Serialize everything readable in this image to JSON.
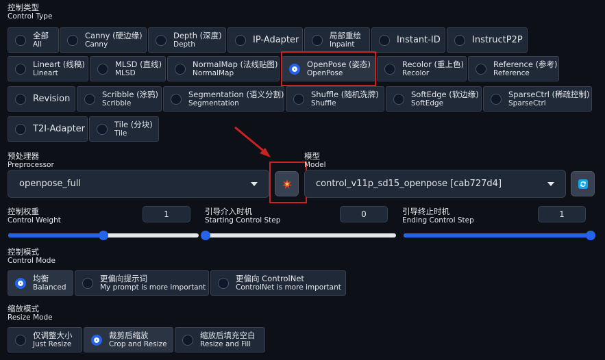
{
  "control_type": {
    "label_cn": "控制类型",
    "label_en": "Control Type",
    "options": [
      {
        "l1": "全部",
        "l2": "All",
        "selected": false
      },
      {
        "l1": "Canny (硬边缘)",
        "l2": "Canny",
        "selected": false
      },
      {
        "l1": "Depth (深度)",
        "l2": "Depth",
        "selected": false
      },
      {
        "l1": "IP-Adapter",
        "l2": "",
        "selected": false
      },
      {
        "l1": "局部重绘",
        "l2": "Inpaint",
        "selected": false
      },
      {
        "l1": "Instant-ID",
        "l2": "",
        "selected": false
      },
      {
        "l1": "InstructP2P",
        "l2": "",
        "selected": false
      },
      {
        "l1": "Lineart (线稿)",
        "l2": "Lineart",
        "selected": false
      },
      {
        "l1": "MLSD (直线)",
        "l2": "MLSD",
        "selected": false
      },
      {
        "l1": "NormalMap (法线贴图)",
        "l2": "NormalMap",
        "selected": false
      },
      {
        "l1": "OpenPose (姿态)",
        "l2": "OpenPose",
        "selected": true
      },
      {
        "l1": "Recolor (重上色)",
        "l2": "Recolor",
        "selected": false
      },
      {
        "l1": "Reference (参考)",
        "l2": "Reference",
        "selected": false
      },
      {
        "l1": "Revision",
        "l2": "",
        "selected": false
      },
      {
        "l1": "Scribble (涂鸦)",
        "l2": "Scribble",
        "selected": false
      },
      {
        "l1": "Segmentation (语义分割)",
        "l2": "Segmentation",
        "selected": false
      },
      {
        "l1": "Shuffle (随机洗牌)",
        "l2": "Shuffle",
        "selected": false
      },
      {
        "l1": "SoftEdge (软边缘)",
        "l2": "SoftEdge",
        "selected": false
      },
      {
        "l1": "SparseCtrl (稀疏控制)",
        "l2": "SparseCtrl",
        "selected": false
      },
      {
        "l1": "T2I-Adapter",
        "l2": "",
        "selected": false
      },
      {
        "l1": "Tile (分块)",
        "l2": "Tile",
        "selected": false
      }
    ]
  },
  "preprocessor": {
    "label_cn": "预处理器",
    "label_en": "Preprocessor",
    "value": "openpose_full"
  },
  "model": {
    "label_cn": "模型",
    "label_en": "Model",
    "value": "control_v11p_sd15_openpose [cab727d4]"
  },
  "run_preprocessor_icon": "explosion-icon",
  "refresh_icon": "refresh-icon",
  "control_weight": {
    "label_cn": "控制权重",
    "label_en": "Control Weight",
    "value": "1",
    "fraction": 0.5
  },
  "starting_step": {
    "label_cn": "引导介入时机",
    "label_en": "Starting Control Step",
    "value": "0",
    "fraction": 0.0
  },
  "ending_step": {
    "label_cn": "引导终止时机",
    "label_en": "Ending Control Step",
    "value": "1",
    "fraction": 1.0
  },
  "control_mode": {
    "label_cn": "控制模式",
    "label_en": "Control Mode",
    "options": [
      {
        "l1": "均衡",
        "l2": "Balanced",
        "selected": true
      },
      {
        "l1": "更偏向提示词",
        "l2": "My prompt is more important",
        "selected": false
      },
      {
        "l1": "更偏向 ControlNet",
        "l2": "ControlNet is more important",
        "selected": false
      }
    ]
  },
  "resize_mode": {
    "label_cn": "缩放模式",
    "label_en": "Resize Mode",
    "options": [
      {
        "l1": "仅调整大小",
        "l2": "Just Resize",
        "selected": false
      },
      {
        "l1": "裁剪后缩放",
        "l2": "Crop and Resize",
        "selected": true
      },
      {
        "l1": "缩放后填充空白",
        "l2": "Resize and Fill",
        "selected": false
      }
    ]
  },
  "colors": {
    "accent": "#2563eb",
    "highlight": "#cc2222",
    "panel": "#1f2937",
    "background": "#0d1117"
  }
}
